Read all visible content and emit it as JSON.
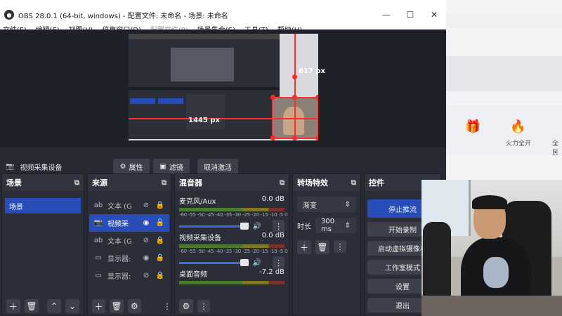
{
  "background": {
    "right_labels": [
      "火力全开",
      "全民"
    ]
  },
  "window": {
    "title": "OBS 28.0.1 (64-bit, windows) - 配置文件: 未命名 - 场景: 未命名",
    "controls": [
      "—",
      "☐",
      "✕"
    ]
  },
  "menu": {
    "file": "文件(F)",
    "edit": "编辑(E)",
    "view": "视图(V)",
    "docks": "停靠窗口(D)",
    "profile": "配置文件(P)",
    "scene_collection": "场景集合(S)",
    "tools": "工具(T)",
    "help": "帮助(H)"
  },
  "preview": {
    "width_label": "1445 px",
    "height_label": "617 px"
  },
  "source_bar": {
    "selected_source": "视频采集设备",
    "properties": "属性",
    "filters": "滤镜",
    "deactivate": "取消激活"
  },
  "scenes": {
    "title": "场景",
    "items": [
      "场景"
    ]
  },
  "sources": {
    "title": "来源",
    "items": [
      {
        "name": "文本 (G",
        "type": "ab",
        "active": false
      },
      {
        "name": "视频采",
        "type": "camera",
        "active": true
      },
      {
        "name": "文本 (G",
        "type": "ab",
        "active": false
      },
      {
        "name": "显示器:",
        "type": "monitor",
        "active": false
      },
      {
        "name": "显示器:",
        "type": "monitor",
        "active": false
      }
    ]
  },
  "mixer": {
    "title": "混音器",
    "ticks": "-60 -55 -50 -45 -40 -35 -30 -25 -20 -15 -10 -5 0",
    "channels": [
      {
        "name": "麦克风/Aux",
        "level": "0.0 dB"
      },
      {
        "name": "视频采集设备",
        "level": "0.0 dB"
      },
      {
        "name": "桌面音频",
        "level": "-7.2 dB"
      }
    ]
  },
  "transitions": {
    "title": "转场特效",
    "type": "渐变",
    "duration_label": "时长",
    "duration_value": "300 ms"
  },
  "controls": {
    "title": "控件",
    "stop_stream": "停止推流",
    "start_record": "开始录制",
    "virtual_cam": "启动虚拟摄像机",
    "studio_mode": "工作室模式",
    "settings": "设置",
    "exit": "退出"
  },
  "colors": {
    "accent": "#284cb8",
    "panel": "#2b2e38",
    "guide": "#ff2a2a"
  }
}
